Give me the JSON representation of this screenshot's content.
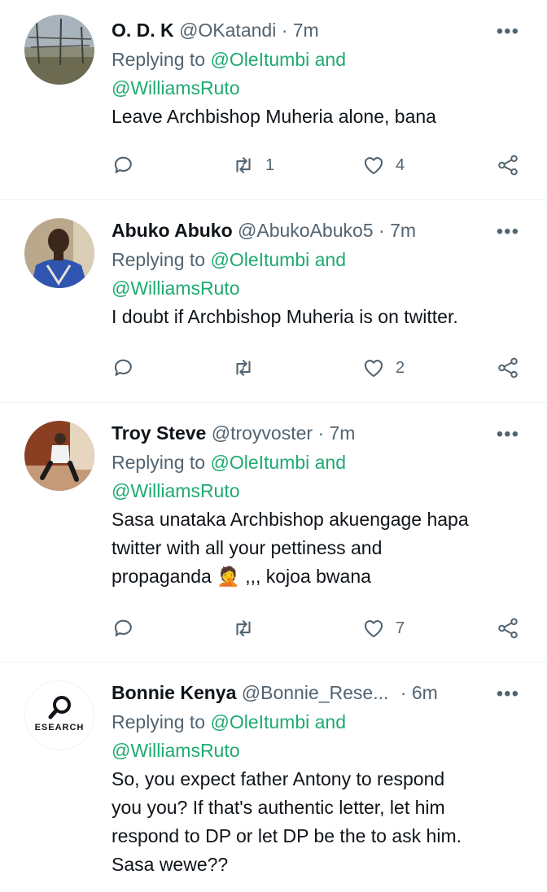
{
  "tweets": [
    {
      "name": "O. D. K",
      "handle": "@OKatandi",
      "time": "7m",
      "replying_prefix": "Replying to",
      "mention1": "@OleItumbi and",
      "mention2": "@WilliamsRuto",
      "text": [
        "Leave Archbishop Muheria alone, bana"
      ],
      "retweets": "1",
      "likes": "4",
      "avatar": "photo"
    },
    {
      "name": "Abuko Abuko",
      "handle": "@AbukoAbuko5",
      "time": "7m",
      "replying_prefix": "Replying to",
      "mention1": "@OleItumbi and",
      "mention2": "@WilliamsRuto",
      "text": [
        "I doubt if Archbishop Muheria is on twitter."
      ],
      "retweets": "",
      "likes": "2",
      "avatar": "photo"
    },
    {
      "name": "Troy Steve",
      "handle": "@troyvoster",
      "time": "7m",
      "replying_prefix": "Replying to",
      "mention1": "@OleItumbi and",
      "mention2": "@WilliamsRuto",
      "text": [
        "Sasa unataka Archbishop akuengage hapa",
        "twitter with all your pettiness and",
        "propaganda 🤦 ,,, kojoa bwana"
      ],
      "retweets": "",
      "likes": "7",
      "avatar": "photo"
    },
    {
      "name": "Bonnie Kenya",
      "handle": "@Bonnie_Rese...",
      "time": "6m",
      "replying_prefix": "Replying to",
      "mention1": "@OleItumbi and",
      "mention2": "@WilliamsRuto",
      "text": [
        "So, you expect father Antony to respond",
        "you you? If that's authentic letter, let him",
        "respond to DP or let DP be the to ask him.",
        "Sasa wewe??"
      ],
      "retweets": "",
      "likes": "",
      "avatar": "logo",
      "avatar_text": "ESEARCH"
    }
  ],
  "dot": "·",
  "more": "•••",
  "colors": {
    "mention": "#1eaa72",
    "muted": "#536471",
    "text": "#0f1419"
  },
  "icons": [
    "reply-icon",
    "retweet-icon",
    "like-icon",
    "share-icon",
    "more-icon"
  ]
}
